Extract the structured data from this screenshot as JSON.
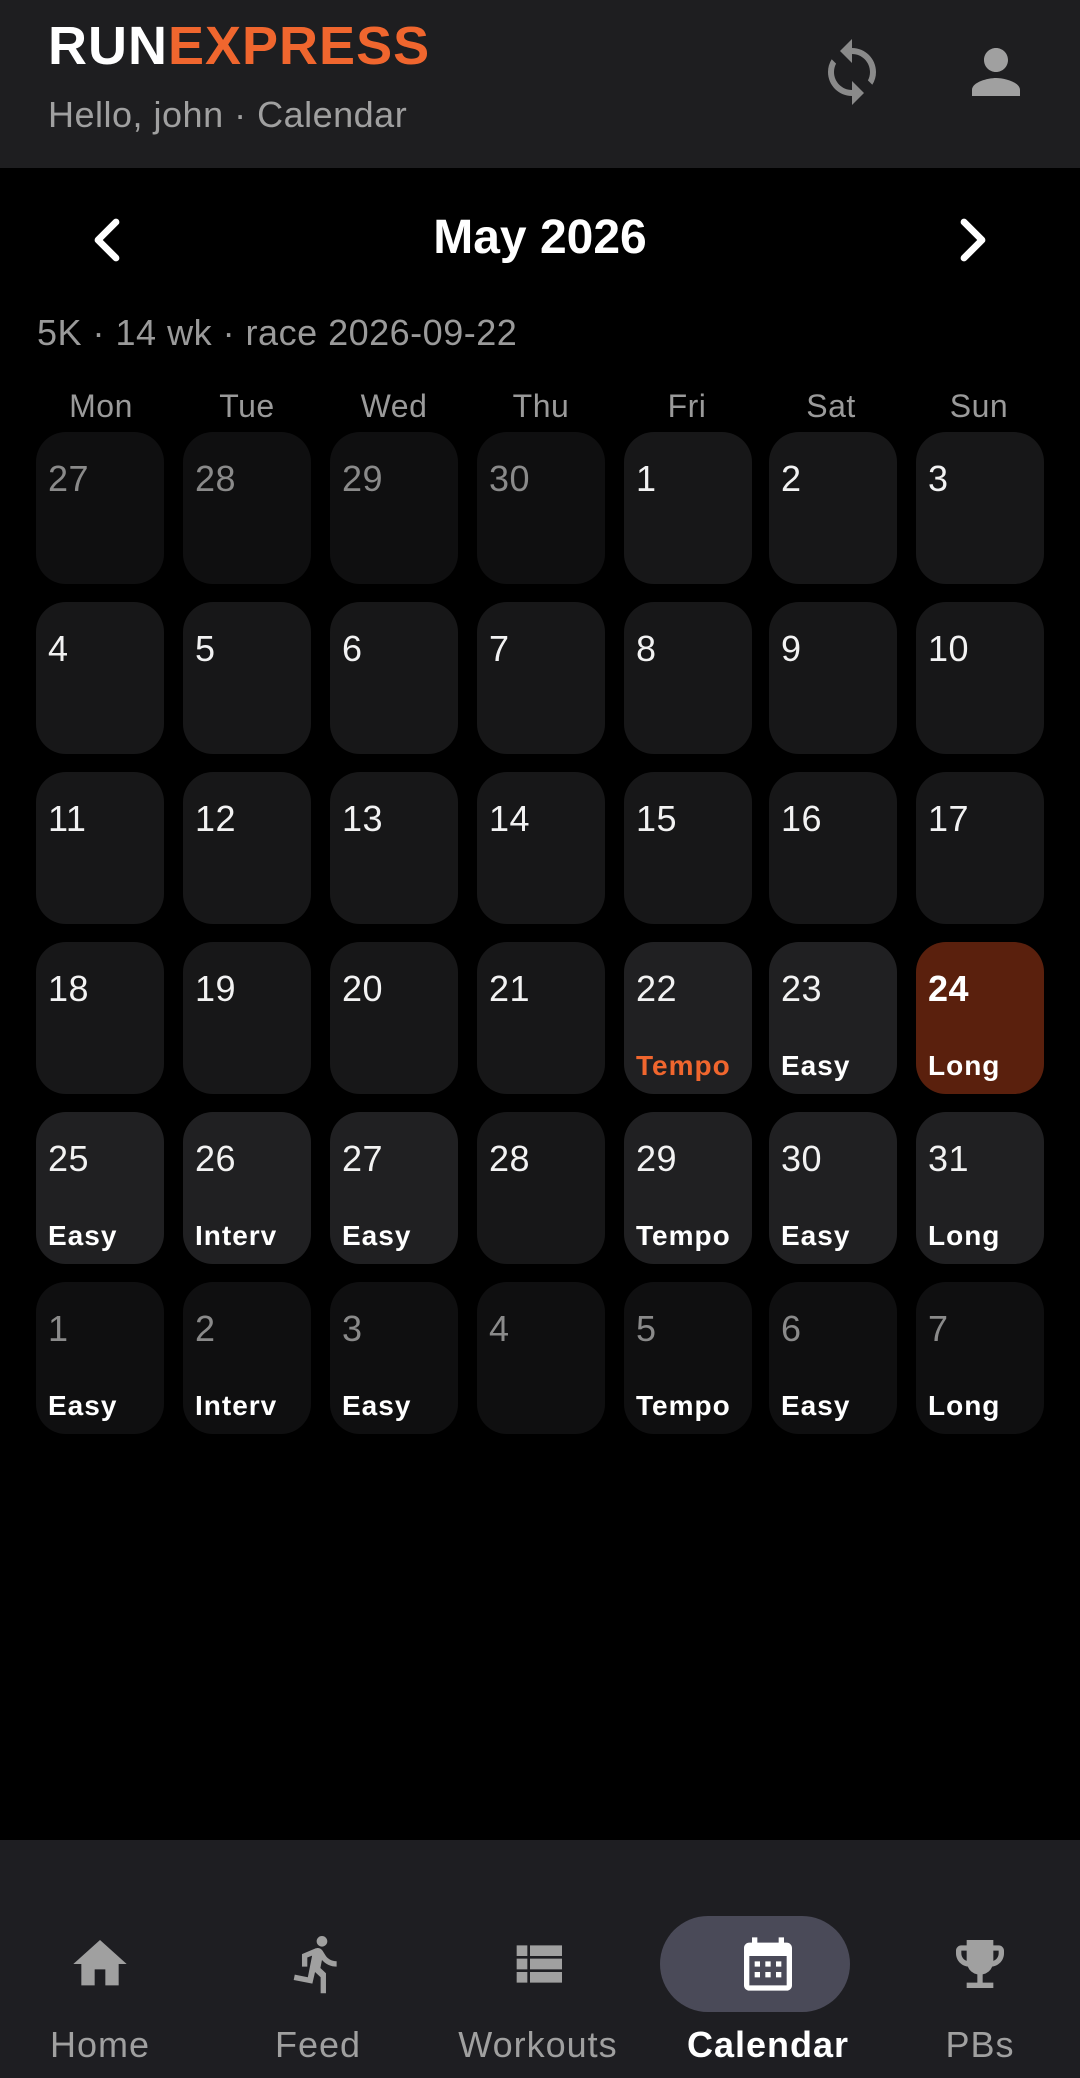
{
  "app": {
    "brand_run": "RUN",
    "brand_express": "EXPRESS",
    "greeting": "Hello, john · Calendar"
  },
  "header_icons": {
    "sync": "sync-icon",
    "profile": "profile-icon"
  },
  "calendar": {
    "month_title": "May 2026",
    "plan_summary": "5K · 14 wk · race 2026-09-22",
    "weekdays": [
      "Mon",
      "Tue",
      "Wed",
      "Thu",
      "Fri",
      "Sat",
      "Sun"
    ],
    "weeks": [
      [
        {
          "day": "27",
          "outside": true
        },
        {
          "day": "28",
          "outside": true
        },
        {
          "day": "29",
          "outside": true
        },
        {
          "day": "30",
          "outside": true
        },
        {
          "day": "1"
        },
        {
          "day": "2"
        },
        {
          "day": "3"
        }
      ],
      [
        {
          "day": "4"
        },
        {
          "day": "5"
        },
        {
          "day": "6"
        },
        {
          "day": "7"
        },
        {
          "day": "8"
        },
        {
          "day": "9"
        },
        {
          "day": "10"
        }
      ],
      [
        {
          "day": "11"
        },
        {
          "day": "12"
        },
        {
          "day": "13"
        },
        {
          "day": "14"
        },
        {
          "day": "15"
        },
        {
          "day": "16"
        },
        {
          "day": "17"
        }
      ],
      [
        {
          "day": "18"
        },
        {
          "day": "19"
        },
        {
          "day": "20"
        },
        {
          "day": "21"
        },
        {
          "day": "22",
          "workout": "Tempo",
          "accent": true
        },
        {
          "day": "23",
          "workout": "Easy"
        },
        {
          "day": "24",
          "workout": "Long",
          "today": true
        }
      ],
      [
        {
          "day": "25",
          "workout": "Easy"
        },
        {
          "day": "26",
          "workout": "Interv"
        },
        {
          "day": "27",
          "workout": "Easy"
        },
        {
          "day": "28"
        },
        {
          "day": "29",
          "workout": "Tempo"
        },
        {
          "day": "30",
          "workout": "Easy"
        },
        {
          "day": "31",
          "workout": "Long"
        }
      ],
      [
        {
          "day": "1",
          "outside": true,
          "workout": "Easy"
        },
        {
          "day": "2",
          "outside": true,
          "workout": "Interv"
        },
        {
          "day": "3",
          "outside": true,
          "workout": "Easy"
        },
        {
          "day": "4",
          "outside": true
        },
        {
          "day": "5",
          "outside": true,
          "workout": "Tempo"
        },
        {
          "day": "6",
          "outside": true,
          "workout": "Easy"
        },
        {
          "day": "7",
          "outside": true,
          "workout": "Long"
        }
      ]
    ]
  },
  "bottom_nav": [
    {
      "label": "Home",
      "icon": "home-icon"
    },
    {
      "label": "Feed",
      "icon": "runner-icon"
    },
    {
      "label": "Workouts",
      "icon": "list-icon"
    },
    {
      "label": "Calendar",
      "icon": "calendar-icon",
      "active": true
    },
    {
      "label": "PBs",
      "icon": "trophy-icon"
    }
  ],
  "colors": {
    "accent": "#f0662e",
    "today_bg": "#5a200d",
    "active_pill": "#4a4a58"
  }
}
